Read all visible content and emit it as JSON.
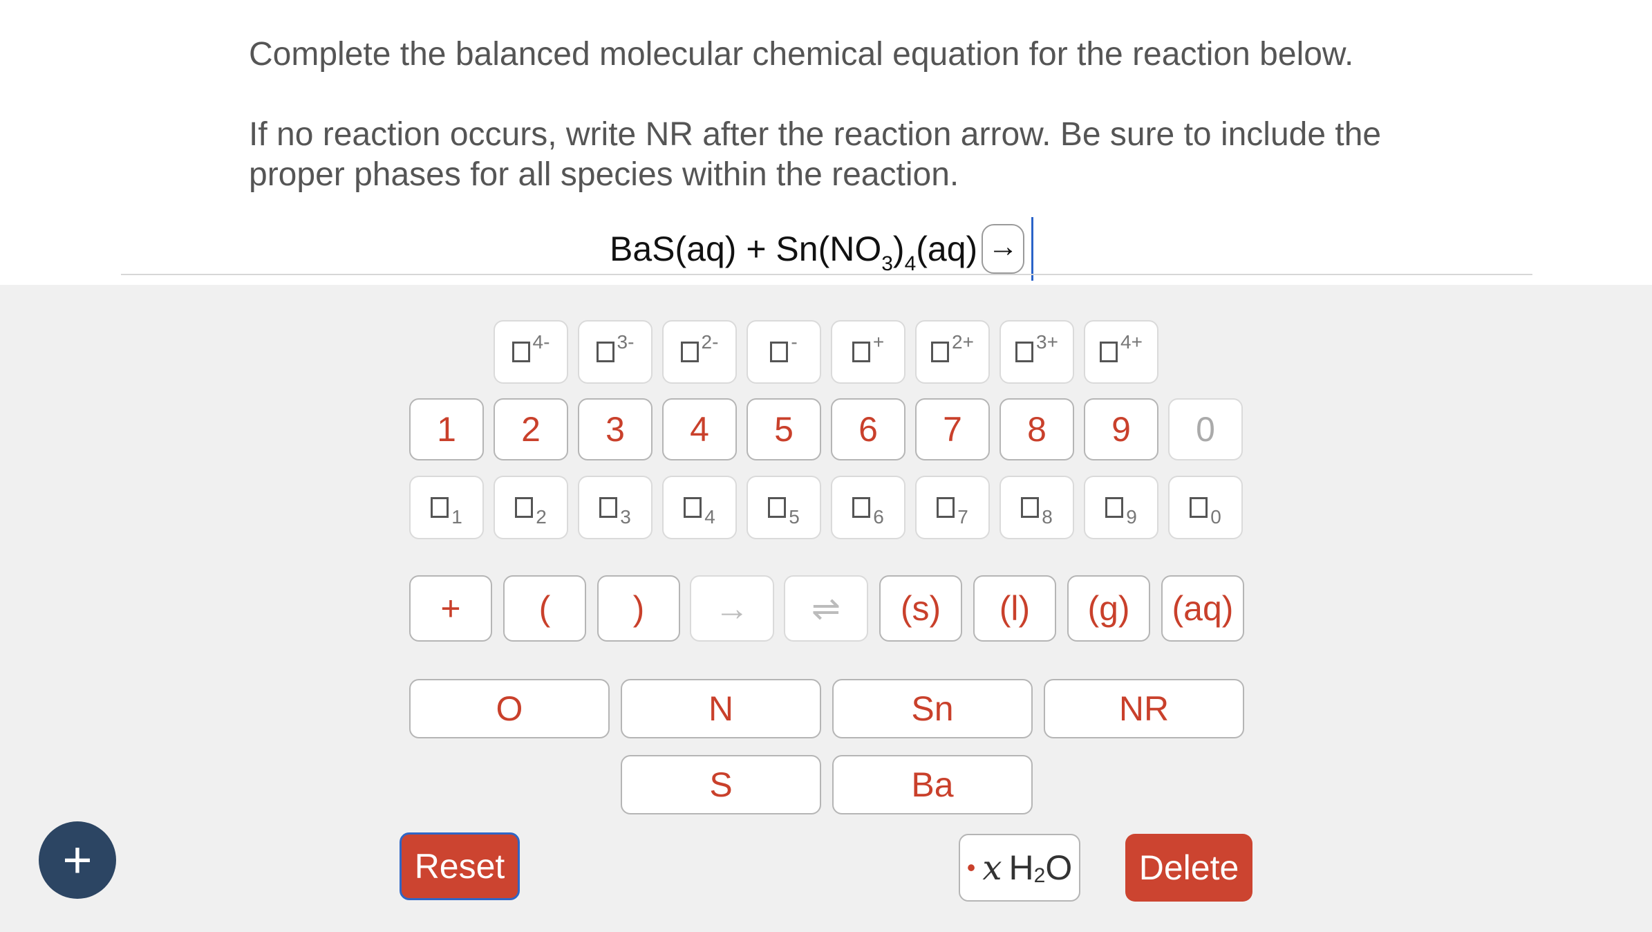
{
  "prompt": {
    "line1": "Complete the balanced molecular chemical equation for the reaction below.",
    "line2": "If no reaction occurs, write NR after the reaction arrow. Be sure to include the proper phases for all species within the reaction."
  },
  "equation": {
    "part1": "BaS(aq) + Sn(NO",
    "sub1": "3",
    "part2": ")",
    "sub2": "4",
    "part3": "(aq)",
    "arrow": "→"
  },
  "keypad": {
    "charge_row": [
      "4-",
      "3-",
      "2-",
      "-",
      "+",
      "2+",
      "3+",
      "4+"
    ],
    "number_row": [
      "1",
      "2",
      "3",
      "4",
      "5",
      "6",
      "7",
      "8",
      "9",
      "0"
    ],
    "subscript_row": [
      "1",
      "2",
      "3",
      "4",
      "5",
      "6",
      "7",
      "8",
      "9",
      "0"
    ],
    "symbol_row": [
      "+",
      "(",
      ")",
      "→",
      "⇌",
      "(s)",
      "(l)",
      "(g)",
      "(aq)"
    ],
    "elements_row1": [
      "O",
      "N",
      "Sn",
      "NR"
    ],
    "elements_row2": [
      "S",
      "Ba"
    ]
  },
  "buttons": {
    "add": "+",
    "reset": "Reset",
    "water_dot": "•",
    "water_x": "x",
    "water_h": "H",
    "water_2": "2",
    "water_o": "O",
    "delete": "Delete"
  },
  "colors": {
    "accent": "#cc4430",
    "focus_border": "#2f66c6",
    "fab": "#2c4563",
    "panel": "#f0f0f0"
  }
}
